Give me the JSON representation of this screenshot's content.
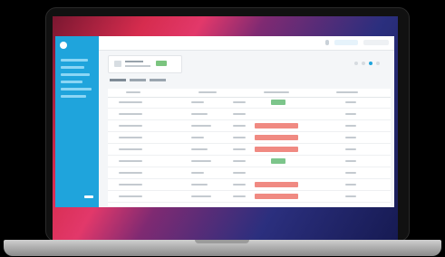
{
  "app": {
    "page_title": "",
    "logo": "",
    "colors": {
      "sidebar": "#1fa4dc",
      "status_ok": "#7cc58b",
      "status_error": "#f08a82"
    }
  },
  "tabs": [],
  "table": {
    "columns": [],
    "rows": [
      {
        "status": "ok"
      },
      {
        "status": ""
      },
      {
        "status": "error"
      },
      {
        "status": "error"
      },
      {
        "status": "error"
      },
      {
        "status": "ok"
      },
      {
        "status": ""
      },
      {
        "status": "error"
      },
      {
        "status": "error"
      }
    ]
  }
}
